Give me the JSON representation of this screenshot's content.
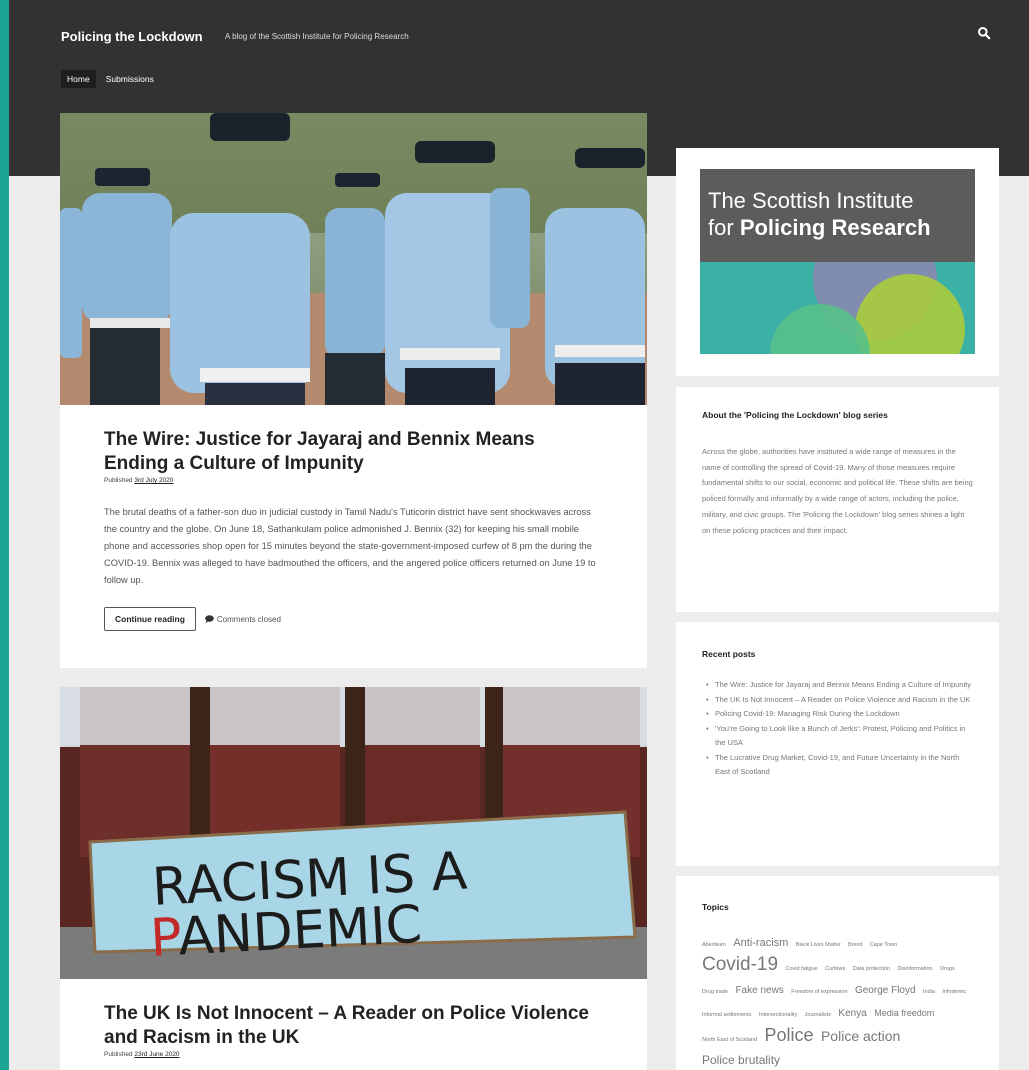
{
  "site": {
    "title": "Policing the Lockdown",
    "tagline": "A blog of the Scottish Institute for Policing Research"
  },
  "nav": {
    "items": [
      "Home",
      "Submissions"
    ],
    "active": "Home"
  },
  "posts": [
    {
      "title": "The Wire: Justice for Jayaraj and Bennix Means Ending a Culture of Impunity",
      "published_label": "Published",
      "date": "3rd July 2020",
      "excerpt": "The brutal deaths of a father-son duo in judicial custody in Tamil Nadu's Tuticorin district have sent shockwaves across the country and the globe. On June 18, Sathankulam police admonished J. Bennix (32) for keeping his small mobile phone and accessories shop open for 15 minutes beyond the state-government-imposed curfew of 8 pm the during the COVID-19. Bennix was alleged to have badmouthed the officers, and the angered police officers returned on June 19 to follow up.",
      "continue_label": "Continue reading",
      "comments_label": "Comments closed"
    },
    {
      "title": "The UK Is Not Innocent – A Reader on Police Violence and Racism in the UK",
      "published_label": "Published",
      "date": "23rd June 2020",
      "sign_line1": "RACISM IS A",
      "sign_line2_first": "P",
      "sign_line2_rest": "ANDEMIC"
    }
  ],
  "sidebar": {
    "logo": {
      "line1": "The Scottish Institute",
      "line2_prefix": "for",
      "line2_bold": "Policing Research"
    },
    "about": {
      "title": "About the 'Policing the Lockdown' blog series",
      "text": "Across the globe, authorities have instituted a wide range of measures in the name of controlling the spread of Covid-19. Many of those measures require fundamental shifts to our social, economic and political life. These shifts are being policed formally and informally by a wide range of actors, including the police, military, and civic groups. The 'Policing the Lockdown' blog series shines a light on these policing practices and their impact."
    },
    "recent": {
      "title": "Recent posts",
      "items": [
        "The Wire: Justice for Jayaraj and Bennix Means Ending a Culture of Impunity",
        "The UK Is Not Innocent – A Reader on Police Violence and Racism in the UK",
        "Policing Covid-19: Managing Risk During the Lockdown",
        "'You're Going to Look like a Bunch of Jerks': Protest, Policing and Politics in the USA",
        "The Lucrative Drug Market, Covid-19, and Future Uncertainty in the North East of Scotland"
      ]
    },
    "topics": {
      "title": "Topics",
      "tags": [
        {
          "label": "Aberdeen",
          "size": 5.5
        },
        {
          "label": "Anti-racism",
          "size": 11
        },
        {
          "label": "Black Lives Matter",
          "size": 5.5
        },
        {
          "label": "Brexit",
          "size": 5.5
        },
        {
          "label": "Cape Town",
          "size": 5.5
        },
        {
          "label": "Covid-19",
          "size": 19
        },
        {
          "label": "Covid fatigue",
          "size": 5.5
        },
        {
          "label": "Curfews",
          "size": 5.5
        },
        {
          "label": "Data protection",
          "size": 5.5
        },
        {
          "label": "Disinformation",
          "size": 5.5
        },
        {
          "label": "Drugs",
          "size": 5.5
        },
        {
          "label": "Drug trade",
          "size": 5.5
        },
        {
          "label": "Fake news",
          "size": 10
        },
        {
          "label": "Freedom of expression",
          "size": 5.5
        },
        {
          "label": "George Floyd",
          "size": 10
        },
        {
          "label": "India",
          "size": 5.5
        },
        {
          "label": "Infodemic",
          "size": 5.5
        },
        {
          "label": "Informal settlements",
          "size": 5.5
        },
        {
          "label": "Intersectionality",
          "size": 5.5
        },
        {
          "label": "Journalists",
          "size": 5.5
        },
        {
          "label": "Kenya",
          "size": 10
        },
        {
          "label": "Media freedom",
          "size": 9
        },
        {
          "label": "North East of Scotland",
          "size": 5.5
        },
        {
          "label": "Police",
          "size": 18
        },
        {
          "label": "Police action",
          "size": 14
        },
        {
          "label": "Police brutality",
          "size": 12
        }
      ]
    }
  }
}
